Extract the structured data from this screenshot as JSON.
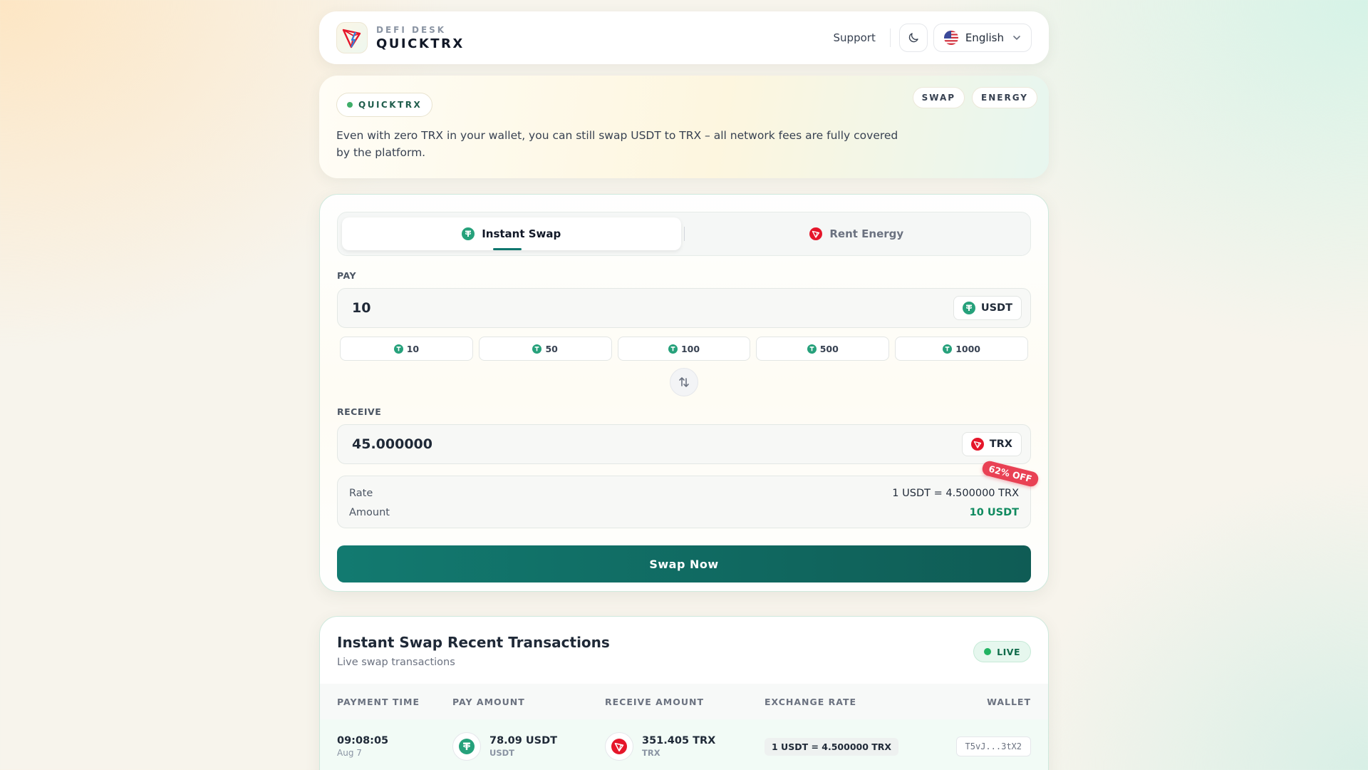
{
  "header": {
    "brand_sub": "DEFI DESK",
    "brand_name": "QUICKTRX",
    "support_label": "Support",
    "language": "English"
  },
  "banner": {
    "brand_pill": "QUICKTRX",
    "description": "Even with zero TRX in your wallet, you can still swap USDT to TRX – all network fees are fully covered by the platform.",
    "tags": [
      "SWAP",
      "ENERGY"
    ]
  },
  "swap": {
    "tabs": [
      {
        "label": "Instant Swap",
        "active": true
      },
      {
        "label": "Rent Energy",
        "active": false
      }
    ],
    "pay_label": "PAY",
    "pay_value": "10",
    "pay_token": "USDT",
    "presets": [
      "10",
      "50",
      "100",
      "500",
      "1000"
    ],
    "receive_label": "RECEIVE",
    "receive_value": "45.000000",
    "receive_token": "TRX",
    "discount": "62% OFF",
    "rate_label": "Rate",
    "rate_value": "1 USDT = 4.500000 TRX",
    "amount_label": "Amount",
    "amount_value": "10 USDT",
    "button_label": "Swap Now"
  },
  "transactions": {
    "title": "Instant Swap Recent Transactions",
    "subtitle": "Live swap transactions",
    "live_label": "LIVE",
    "columns": [
      "PAYMENT TIME",
      "PAY AMOUNT",
      "RECEIVE AMOUNT",
      "EXCHANGE RATE",
      "WALLET"
    ],
    "rows": [
      {
        "time": "09:08:05",
        "date": "Aug 7",
        "pay_amount": "78.09 USDT",
        "pay_unit": "USDT",
        "receive_amount": "351.405 TRX",
        "receive_unit": "TRX",
        "rate": "1 USDT = 4.500000 TRX",
        "wallet": "T5vJ...3tX2"
      }
    ]
  },
  "colors": {
    "accent": "#0f766e",
    "usdt": "#26a17b",
    "trx": "#e5162a",
    "discount": "#e94154",
    "live": "#22b362"
  },
  "icons": {
    "logo": "tron-logo-icon",
    "theme": "moon-icon",
    "flag": "us-flag-icon",
    "usdt": "tether-icon",
    "trx": "tron-icon",
    "swap": "swap-arrows-icon"
  }
}
